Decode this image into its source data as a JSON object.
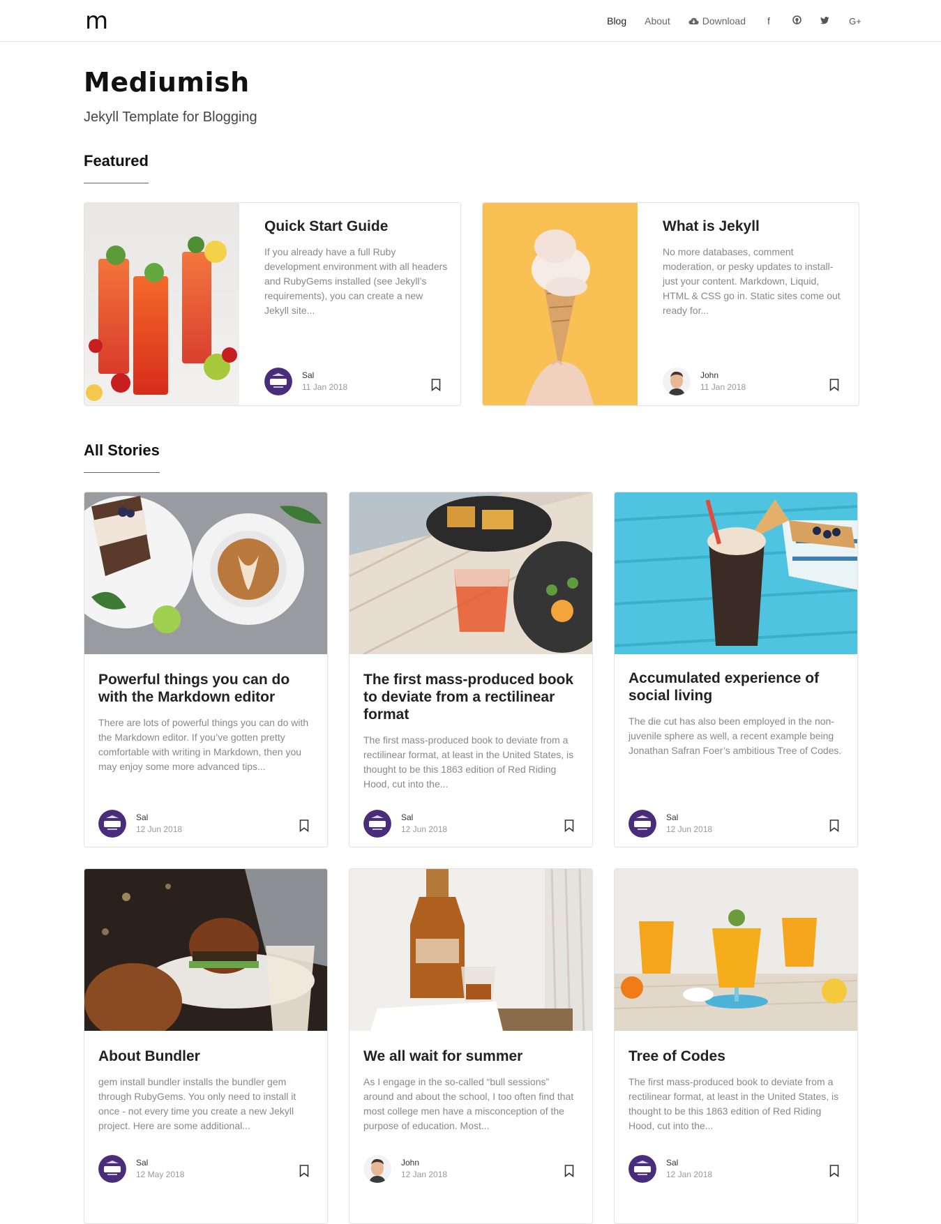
{
  "brand": {
    "logo_text": "m"
  },
  "nav": {
    "items": [
      "Blog",
      "About"
    ],
    "download_label": "Download",
    "social_icons": [
      "facebook-icon",
      "github-icon",
      "twitter-icon",
      "google-plus-icon"
    ],
    "social_glyphs": [
      "f",
      "◉",
      "🐦",
      "G+"
    ]
  },
  "hero": {
    "title": "Mediumish",
    "subtitle": "Jekyll Template for Blogging"
  },
  "featured": {
    "heading": "Featured",
    "posts": [
      {
        "title": "Quick Start Guide",
        "excerpt": "If you already have a full Ruby development environment with all headers and RubyGems installed (see Jekyll’s requirements), you can create a new Jekyll site...",
        "author": "Sal",
        "date": "11 Jan 2018"
      },
      {
        "title": "What is Jekyll",
        "excerpt": "No more databases, comment moderation, or pesky updates to install-just your content. Markdown, Liquid, HTML & CSS go in. Static sites come out ready for...",
        "author": "John",
        "date": "11 Jan 2018"
      }
    ]
  },
  "stories": {
    "heading": "All Stories",
    "posts": [
      {
        "title": "Powerful things you can do with the Markdown editor",
        "excerpt": "There are lots of powerful things you can do with the Markdown editor. If you’ve gotten pretty comfortable with writing in Markdown, then you may enjoy some more advanced tips...",
        "author": "Sal",
        "date": "12 Jun 2018"
      },
      {
        "title": "The first mass-produced book to deviate from a rectilinear format",
        "excerpt": "The first mass-produced book to deviate from a rectilinear format, at least in the United States, is thought to be this 1863 edition of Red Riding Hood, cut into the...",
        "author": "Sal",
        "date": "12 Jun 2018"
      },
      {
        "title": "Accumulated experience of social living",
        "excerpt": "The die cut has also been employed in the non-juvenile sphere as well, a recent example being Jonathan Safran Foer’s ambitious Tree of Codes.",
        "author": "Sal",
        "date": "12 Jun 2018"
      },
      {
        "title": "About Bundler",
        "excerpt": "gem install bundler installs the bundler gem through RubyGems. You only need to install it once - not every time you create a new Jekyll project. Here are some additional...",
        "author": "Sal",
        "date": "12 May 2018"
      },
      {
        "title": "We all wait for summer",
        "excerpt": "As I engage in the so-called “bull sessions” around and about the school, I too often find that most college men have a misconception of the purpose of education. Most...",
        "author": "John",
        "date": "12 Jan 2018"
      },
      {
        "title": "Tree of Codes",
        "excerpt": "The first mass-produced book to deviate from a rectilinear format, at least in the United States, is thought to be this 1863 edition of Red Riding Hood, cut into the...",
        "author": "Sal",
        "date": "12 Jan 2018"
      }
    ]
  },
  "colors": {
    "brand_purple": "#4a2d7a",
    "text_dark": "#222222",
    "text_muted": "#888888"
  }
}
